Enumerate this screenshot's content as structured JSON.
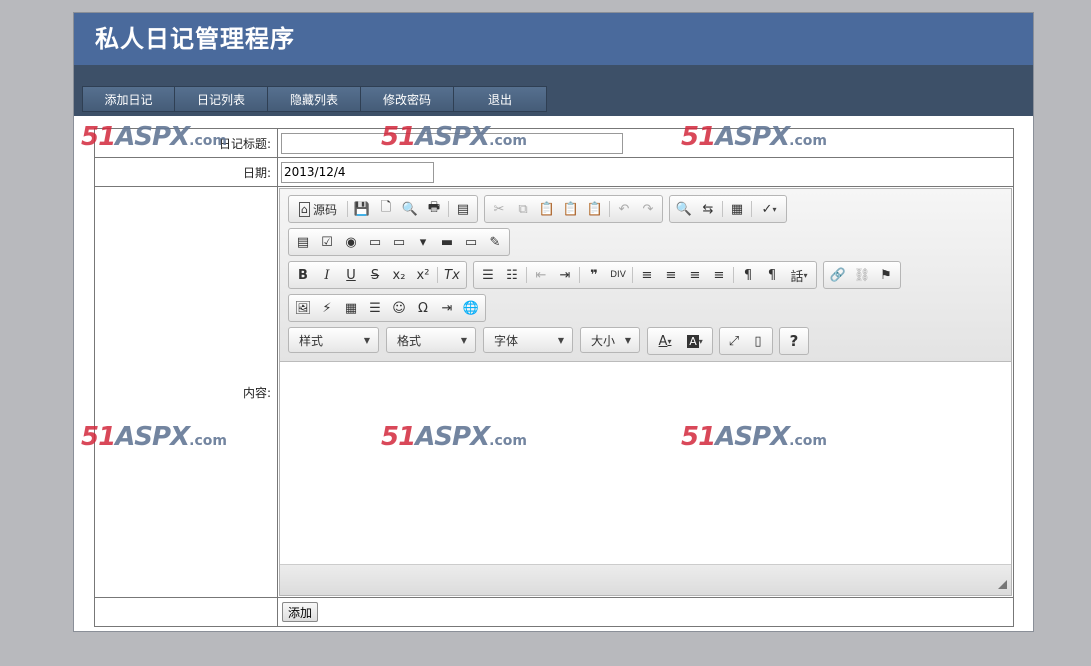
{
  "app": {
    "title": "私人日记管理程序"
  },
  "menu": [
    {
      "label": "添加日记"
    },
    {
      "label": "日记列表"
    },
    {
      "label": "隐藏列表"
    },
    {
      "label": "修改密码"
    },
    {
      "label": "退出"
    }
  ],
  "form": {
    "title_label": "日记标题:",
    "title_value": "",
    "date_label": "日期:",
    "date_value": "2013/12/4",
    "content_label": "内容:",
    "submit_label": "添加"
  },
  "toolbar": {
    "source_label": "源码",
    "styles_label": "样式",
    "format_label": "格式",
    "font_label": "字体",
    "size_label": "大小",
    "help_label": "?"
  },
  "watermark": {
    "digits": "51",
    "brand": "ASPX",
    "suffix": ".com"
  },
  "colors": {
    "header": "#4a6a9c",
    "navbar": "#3d5068",
    "background": "#b8b9bd",
    "watermark": "#d2283c"
  }
}
